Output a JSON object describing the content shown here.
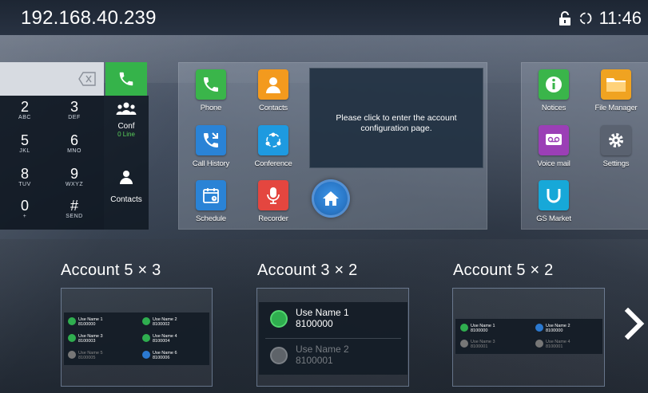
{
  "status_bar": {
    "ip_address": "192.168.40.239",
    "lock_icon": "lock-icon",
    "sync_icon": "sync-icon",
    "time": "11:46"
  },
  "dialer": {
    "backspace_icon": "backspace-icon",
    "call_icon": "phone-icon",
    "keys": [
      {
        "num": "2",
        "sub": "ABC"
      },
      {
        "num": "3",
        "sub": "DEF"
      },
      {
        "num": "5",
        "sub": "JKL"
      },
      {
        "num": "6",
        "sub": "MNO"
      },
      {
        "num": "8",
        "sub": "TUV"
      },
      {
        "num": "9",
        "sub": "WXYZ"
      },
      {
        "num": "0",
        "sub": "+"
      },
      {
        "num": "#",
        "sub": "SEND"
      }
    ],
    "conf": {
      "label": "Conf",
      "sub": "0 Line"
    },
    "contacts": {
      "label": "Contacts"
    }
  },
  "apps": [
    {
      "label": "Phone",
      "icon": "phone-icon",
      "color": "#3ab54a"
    },
    {
      "label": "Contacts",
      "icon": "contact-person-icon",
      "color": "#f39a1e"
    },
    {
      "label": "Call History",
      "icon": "call-history-icon",
      "color": "#2a83d6"
    },
    {
      "label": "Conference",
      "icon": "conference-icon",
      "color": "#1e9ae0"
    },
    {
      "label": "Schedule",
      "icon": "calendar-icon",
      "color": "#2a83d6"
    },
    {
      "label": "Recorder",
      "icon": "microphone-icon",
      "color": "#e4463f"
    }
  ],
  "tooltip": {
    "text": "Please click to enter the account configuration page."
  },
  "home_button": {
    "icon": "home-icon"
  },
  "apps_right": [
    {
      "label": "Notices",
      "icon": "info-icon",
      "color": "#3ab54a"
    },
    {
      "label": "File Manager",
      "icon": "folder-icon",
      "color": "#f0a321"
    },
    {
      "label": "Voice mail",
      "icon": "voicemail-icon",
      "color": "#9b3fb6"
    },
    {
      "label": "Settings",
      "icon": "gear-icon",
      "color": "#5a6270"
    },
    {
      "label": "GS Market",
      "icon": "market-icon",
      "color": "#17a8d8"
    }
  ],
  "widgets": [
    {
      "title": "Account   5 × 3",
      "entries": [
        {
          "name": "Use Name 1",
          "number": "8100000",
          "state": "green"
        },
        {
          "name": "Use Name 2",
          "number": "8100002",
          "state": "green"
        },
        {
          "name": "Use Name 3",
          "number": "8100003",
          "state": "green"
        },
        {
          "name": "Use Name 4",
          "number": "8100004",
          "state": "green"
        },
        {
          "name": "Use Name 5",
          "number": "8100005",
          "state": "gray"
        },
        {
          "name": "Use Name 6",
          "number": "8100006",
          "state": "blue"
        }
      ]
    },
    {
      "title": "Account   3 × 2",
      "entries": [
        {
          "name": "Use Name 1",
          "number": "8100000",
          "state": "green"
        },
        {
          "name": "Use Name 2",
          "number": "8100001",
          "state": "gray"
        }
      ]
    },
    {
      "title": "Account   5 × 2",
      "entries": [
        {
          "name": "Use Name 1",
          "number": "8100000",
          "state": "green"
        },
        {
          "name": "Use Name 2",
          "number": "8100000",
          "state": "blue"
        },
        {
          "name": "Use Name 3",
          "number": "8100001",
          "state": "gray"
        },
        {
          "name": "Use Name 4",
          "number": "8100001",
          "state": "gray"
        }
      ]
    }
  ],
  "next_icon": "chevron-right-icon"
}
